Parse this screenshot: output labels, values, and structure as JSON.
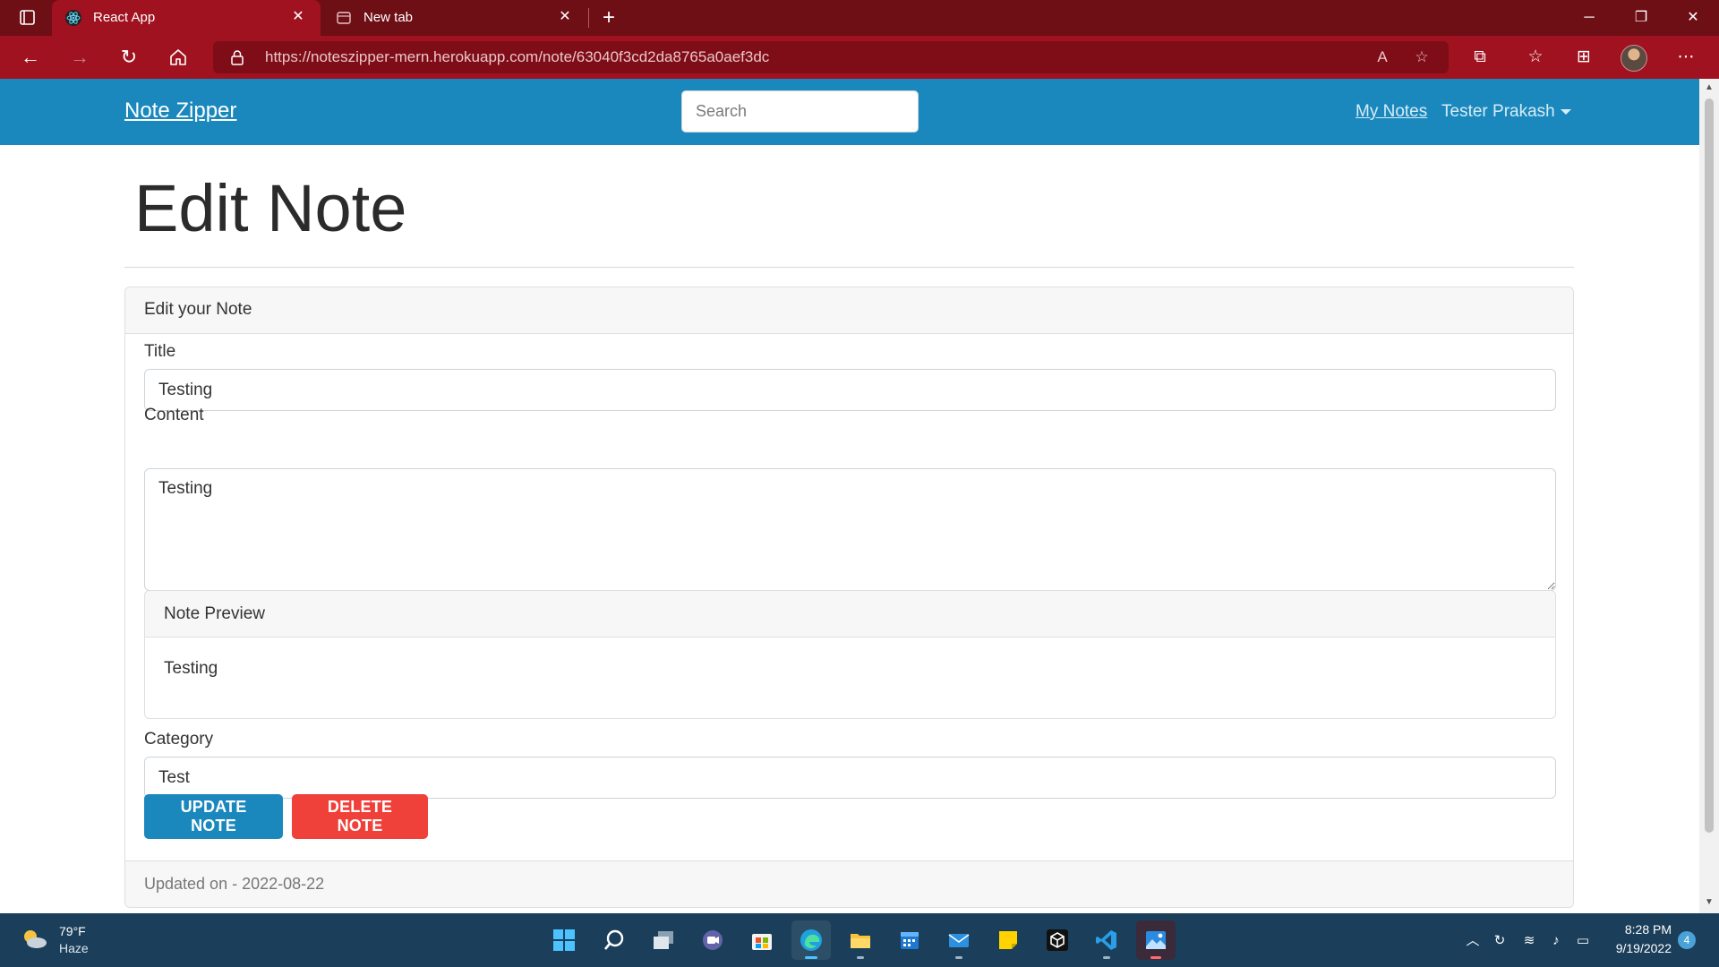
{
  "browser": {
    "tabs": [
      {
        "title": "React App",
        "active": true
      },
      {
        "title": "New tab",
        "active": false
      }
    ],
    "url": "https://noteszipper-mern.herokuapp.com/note/63040f3cd2da8765a0aef3dc",
    "accent_color": "#a0121f",
    "tabbar_color": "#6e0e15"
  },
  "app": {
    "brand": "Note Zipper",
    "search_placeholder": "Search",
    "nav_link": "My Notes",
    "user_name": "Tester Prakash",
    "primary_color": "#1a88bd",
    "danger_color": "#f0403a"
  },
  "page": {
    "title": "Edit Note",
    "card_header": "Edit your Note",
    "title_label": "Title",
    "title_value": "Testing",
    "content_label": "Content",
    "content_value": "Testing",
    "preview_header": "Note Preview",
    "preview_text": "Testing",
    "category_label": "Category",
    "category_value": "Test",
    "update_button": "Update Note",
    "delete_button": "Delete Note",
    "footer_text": "Updated on - 2022-08-22"
  },
  "taskbar": {
    "weather_temp": "79°F",
    "weather_condition": "Haze",
    "time": "8:28 PM",
    "date": "9/19/2022",
    "notification_count": "4",
    "apps": [
      "start-icon",
      "search-icon",
      "task-view-icon",
      "chat-icon",
      "store-icon",
      "edge-icon",
      "file-explorer-icon",
      "calendar-icon",
      "mail-icon",
      "sticky-notes-icon",
      "box-icon",
      "vscode-icon",
      "photos-icon"
    ]
  }
}
